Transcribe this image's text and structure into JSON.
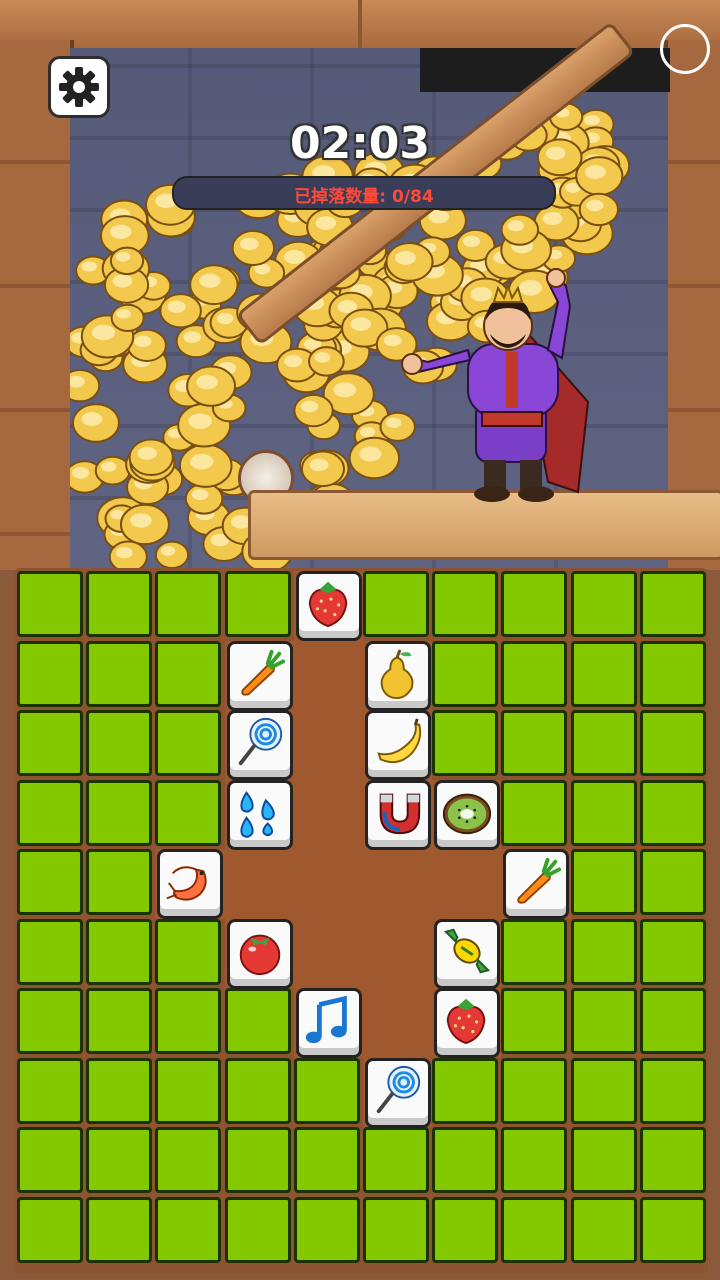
{
  "hud": {
    "timer": "02:03",
    "fallen_label": "已掉落数量:",
    "fallen_count": "0/84",
    "fallen_progress": 0
  },
  "board": {
    "cols": 10,
    "rows": 10,
    "tiles": [
      {
        "icon": "strawberry-icon",
        "col": 4,
        "row": 0
      },
      {
        "icon": "carrot-icon",
        "col": 3,
        "row": 1
      },
      {
        "icon": "pear-icon",
        "col": 5,
        "row": 1
      },
      {
        "icon": "lollipop-icon",
        "col": 3,
        "row": 2
      },
      {
        "icon": "banana-icon",
        "col": 5,
        "row": 2
      },
      {
        "icon": "water-drops-icon",
        "col": 3,
        "row": 3
      },
      {
        "icon": "magnet-icon",
        "col": 5,
        "row": 3
      },
      {
        "icon": "kiwi-icon",
        "col": 6,
        "row": 3
      },
      {
        "icon": "shrimp-icon",
        "col": 2,
        "row": 4
      },
      {
        "icon": "carrot-icon",
        "col": 7,
        "row": 4
      },
      {
        "icon": "tomato-icon",
        "col": 3,
        "row": 5
      },
      {
        "icon": "candy-icon",
        "col": 6,
        "row": 5
      },
      {
        "icon": "music-note-icon",
        "col": 4,
        "row": 6
      },
      {
        "icon": "strawberry-icon",
        "col": 6,
        "row": 6
      },
      {
        "icon": "lollipop-icon",
        "col": 5,
        "row": 7
      }
    ],
    "empty_cells": [
      [
        4,
        1
      ],
      [
        4,
        2
      ],
      [
        4,
        3
      ],
      [
        4,
        4
      ],
      [
        5,
        4
      ],
      [
        6,
        4
      ],
      [
        3,
        4
      ],
      [
        4,
        5
      ],
      [
        5,
        5
      ],
      [
        5,
        6
      ]
    ]
  },
  "colors": {
    "grass": "#84c800",
    "dirt": "#a0582e",
    "gold": "#f2c94c"
  }
}
